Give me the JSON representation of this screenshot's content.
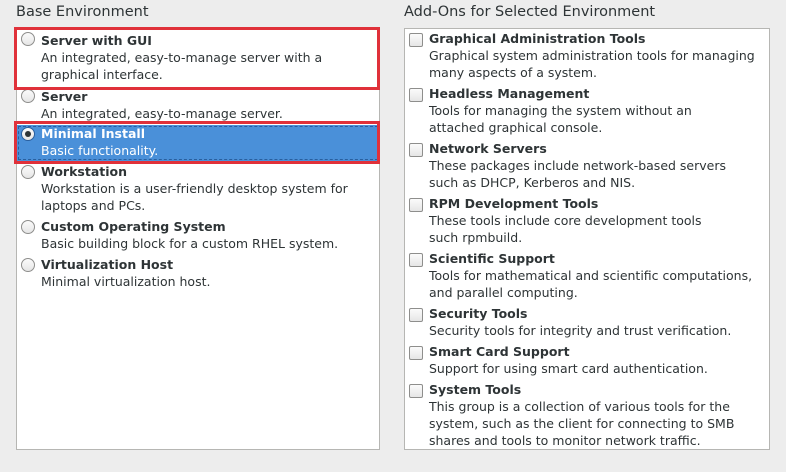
{
  "base_environment": {
    "heading": "Base Environment",
    "items": [
      {
        "title": "Server with GUI",
        "desc": "An integrated, easy-to-manage server with a graphical interface.",
        "selected": false
      },
      {
        "title": "Server",
        "desc": "An integrated, easy-to-manage server.",
        "selected": false
      },
      {
        "title": "Minimal Install",
        "desc": "Basic functionality.",
        "selected": true
      },
      {
        "title": "Workstation",
        "desc": "Workstation is a user-friendly desktop system for laptops and PCs.",
        "selected": false
      },
      {
        "title": "Custom Operating System",
        "desc": "Basic building block for a custom RHEL system.",
        "selected": false
      },
      {
        "title": "Virtualization Host",
        "desc": "Minimal virtualization host.",
        "selected": false
      }
    ]
  },
  "addons": {
    "heading": "Add-Ons for Selected Environment",
    "items": [
      {
        "title": "Graphical Administration Tools",
        "desc": "Graphical system administration tools for managing many aspects of a system.",
        "checked": false
      },
      {
        "title": "Headless Management",
        "desc": "Tools for managing the system without an attached graphical console.",
        "checked": false
      },
      {
        "title": "Network Servers",
        "desc": "These packages include network-based servers such as DHCP, Kerberos and NIS.",
        "checked": false
      },
      {
        "title": "RPM Development Tools",
        "desc": "These tools include core development tools such rpmbuild.",
        "checked": false
      },
      {
        "title": "Scientific Support",
        "desc": "Tools for mathematical and scientific computations, and parallel computing.",
        "checked": false
      },
      {
        "title": "Security Tools",
        "desc": "Security tools for integrity and trust verification.",
        "checked": false
      },
      {
        "title": "Smart Card Support",
        "desc": "Support for using smart card authentication.",
        "checked": false
      },
      {
        "title": "System Tools",
        "desc": "This group is a collection of various tools for the system, such as the client for connecting to SMB shares and tools to monitor network traffic.",
        "checked": false
      }
    ]
  },
  "colors": {
    "selection": "#4a90d9",
    "annotation_red": "#e0313a"
  }
}
